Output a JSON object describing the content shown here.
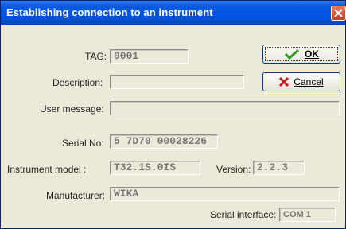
{
  "window": {
    "title": "Establishing connection to an instrument"
  },
  "buttons": {
    "ok_label": "OK",
    "cancel_label": "Cancel"
  },
  "fields": {
    "tag": {
      "label": "TAG:",
      "value": "0001"
    },
    "description": {
      "label": "Description:",
      "value": ""
    },
    "user_message": {
      "label": "User message:",
      "value": ""
    },
    "serial_no": {
      "label": "Serial No:",
      "value": "5 7D70 00028226"
    },
    "instrument_model": {
      "label": "Instrument model :",
      "value": "T32.1S.0IS"
    },
    "version": {
      "label": "Version:",
      "value": "2.2.3"
    },
    "manufacturer": {
      "label": "Manufacturer:",
      "value": "WIKA"
    },
    "serial_interface": {
      "label": "Serial interface:",
      "value": "COM 1"
    }
  },
  "colors": {
    "title_bar": "#0054e3",
    "window_bg": "#ece9d8",
    "ok_check": "#2f9a2a",
    "cancel_x": "#c0201f"
  }
}
